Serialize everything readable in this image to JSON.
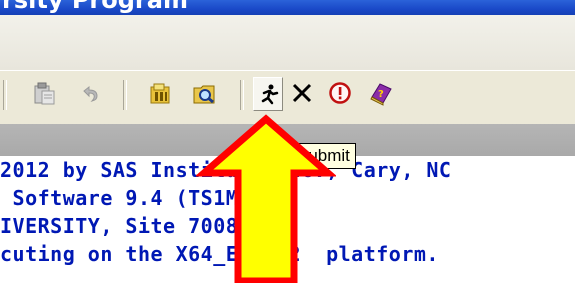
{
  "window": {
    "title_fragment": "rsity Program"
  },
  "toolbar": {
    "buttons": [
      {
        "name": "edit-button",
        "icon": "clipboard-icon"
      },
      {
        "name": "paste-button",
        "icon": "paste-icon"
      },
      {
        "name": "undo-button",
        "icon": "undo-icon"
      },
      {
        "name": "new-library-button",
        "icon": "library-icon"
      },
      {
        "name": "explorer-button",
        "icon": "folder-search-icon"
      },
      {
        "name": "submit-button",
        "icon": "running-man-icon",
        "tooltip": "Submit"
      },
      {
        "name": "clear-button",
        "icon": "x-icon"
      },
      {
        "name": "break-button",
        "icon": "exclamation-circle-icon"
      },
      {
        "name": "help-button",
        "icon": "help-book-icon"
      }
    ]
  },
  "log": {
    "lines": [
      "2012 by SAS Institute Inc., Cary, NC",
      " Software 9.4 (TS1M0)",
      "IVERSITY, Site 70085278.",
      "cuting on the X64_ES08R2  platform."
    ]
  },
  "tooltip": "Submit",
  "colors": {
    "title_bar": "#1a49c8",
    "log_text": "#0018b4",
    "arrow_fill": "#ffff00",
    "arrow_border": "#ff0000"
  }
}
